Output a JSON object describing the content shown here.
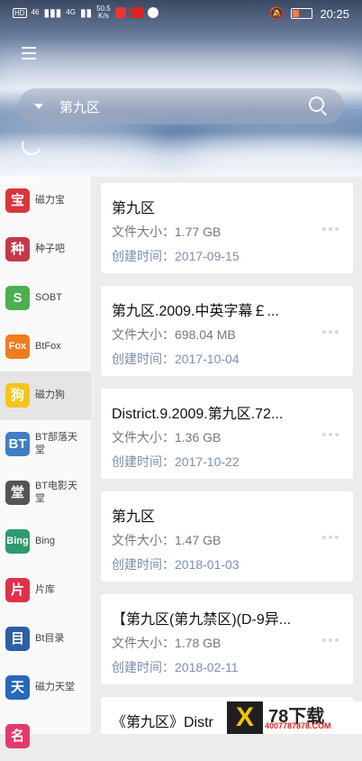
{
  "status_bar": {
    "left_badges": [
      "HD",
      "46",
      "4G"
    ],
    "net_speed_value": "50.5",
    "net_speed_unit": "K/s",
    "time": "20:25",
    "battery_level": 0.35
  },
  "search": {
    "query": "第九区"
  },
  "sidebar": {
    "items": [
      {
        "icon": "宝",
        "label": "磁力宝",
        "color": "#d9363e"
      },
      {
        "icon": "种",
        "label": "种子吧",
        "color": "#c23a4a"
      },
      {
        "icon": "S",
        "label": "SOBT",
        "color": "#4caf50"
      },
      {
        "icon": "Fox",
        "label": "BtFox",
        "color": "#f07c1e"
      },
      {
        "icon": "狗",
        "label": "磁力狗",
        "color": "#f5c518"
      },
      {
        "icon": "BT",
        "label": "BT部落天堂",
        "color": "#3f7ec2"
      },
      {
        "icon": "堂",
        "label": "BT电影天堂",
        "color": "#555555"
      },
      {
        "icon": "Bing",
        "label": "Bing",
        "color": "#2e9a6e"
      },
      {
        "icon": "片",
        "label": "片库",
        "color": "#e0304a"
      },
      {
        "icon": "目",
        "label": "Bt目录",
        "color": "#2d5fa6"
      },
      {
        "icon": "天",
        "label": "磁力天堂",
        "color": "#2868b8"
      },
      {
        "icon": "名",
        "label": "",
        "color": "#e33a6a"
      }
    ],
    "active_index": 4
  },
  "results": [
    {
      "title": "第九区",
      "size_label": "文件大小：",
      "size": "1.77 GB",
      "date_label": "创建时间：",
      "date": "2017-09-15"
    },
    {
      "title": "第九区.2009.中英字幕￡...",
      "size_label": "文件大小：",
      "size": "698.04 MB",
      "date_label": "创建时间：",
      "date": "2017-10-04"
    },
    {
      "title": "District.9.2009.第九区.72...",
      "size_label": "文件大小：",
      "size": "1.36 GB",
      "date_label": "创建时间：",
      "date": "2017-10-22"
    },
    {
      "title": "第九区",
      "size_label": "文件大小：",
      "size": "1.47 GB",
      "date_label": "创建时间：",
      "date": "2018-01-03"
    },
    {
      "title": "【第九区(第九禁区)(D-9异...",
      "size_label": "文件大小：",
      "size": "1.78 GB",
      "date_label": "创建时间：",
      "date": "2018-02-11"
    },
    {
      "title": "《第九区》Distr",
      "size_label": "",
      "size": "",
      "date_label": "",
      "date": ""
    }
  ],
  "watermark": {
    "mark": "X",
    "brand": "78下载",
    "phone": "4007787878.COM"
  }
}
